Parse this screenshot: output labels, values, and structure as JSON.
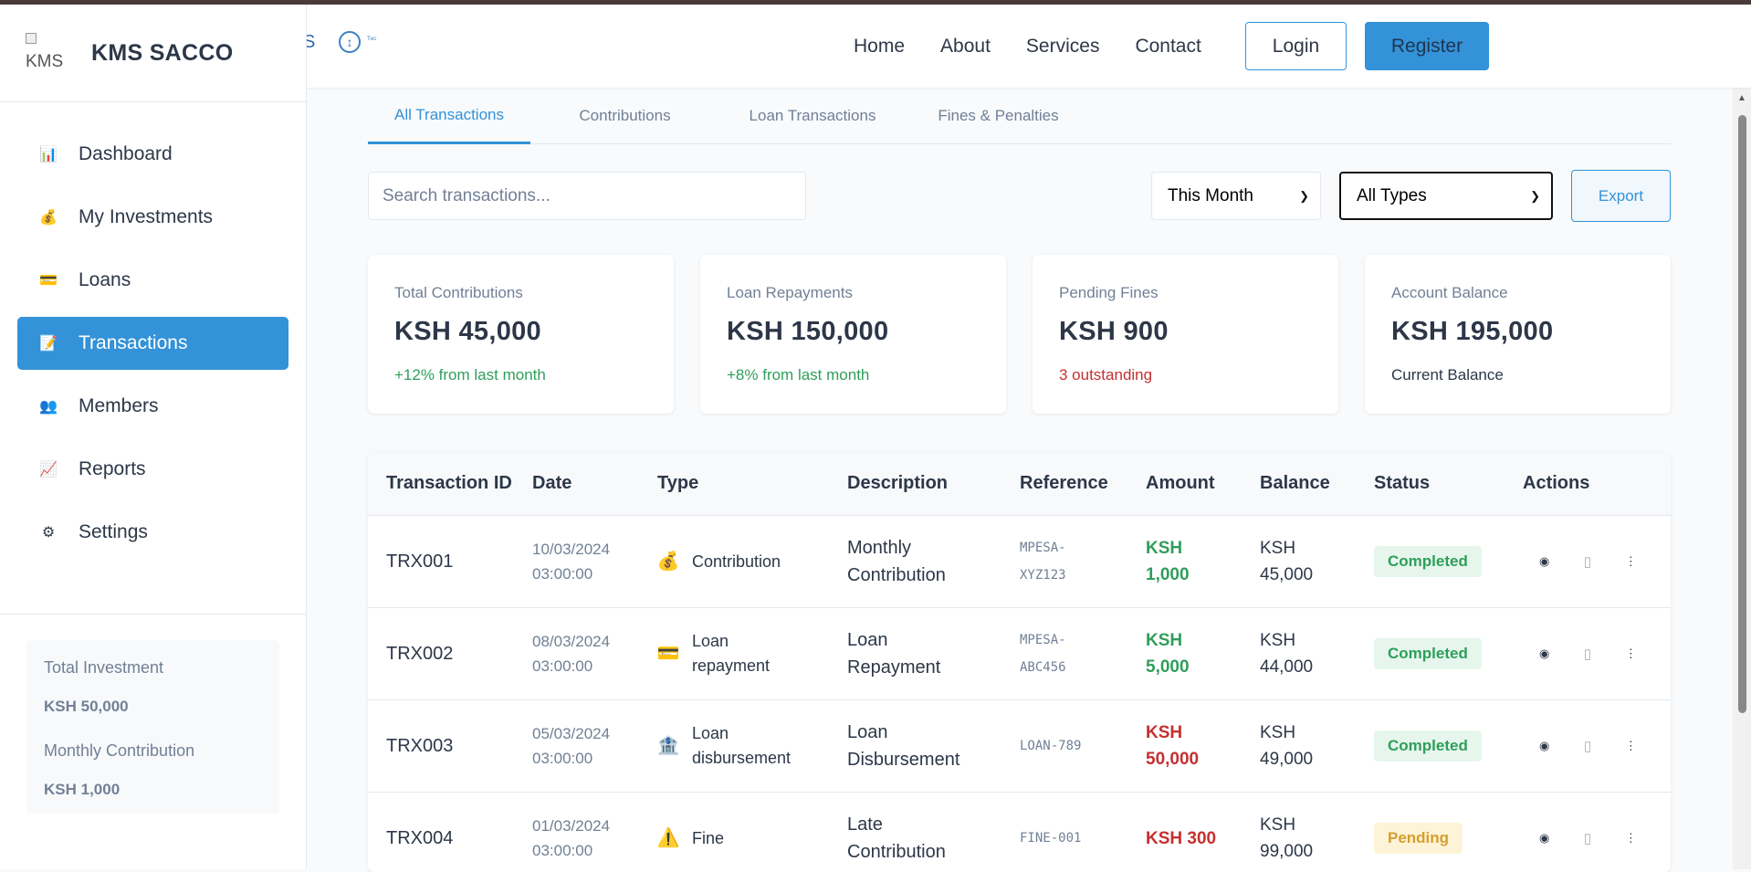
{
  "brand": {
    "logo_alt": "KMS",
    "name": "KMS SACCO"
  },
  "sidebar": {
    "items": [
      {
        "label": "Dashboard",
        "icon": "bar-chart-icon",
        "glyph": "📊"
      },
      {
        "label": "My Investments",
        "icon": "money-bag-icon",
        "glyph": "💰"
      },
      {
        "label": "Loans",
        "icon": "credit-card-icon",
        "glyph": "💳"
      },
      {
        "label": "Transactions",
        "icon": "memo-icon",
        "glyph": "📝"
      },
      {
        "label": "Members",
        "icon": "people-icon",
        "glyph": "👥"
      },
      {
        "label": "Reports",
        "icon": "trend-chart-icon",
        "glyph": "📈"
      },
      {
        "label": "Settings",
        "icon": "gear-icon",
        "glyph": "⚙"
      }
    ],
    "active_index": 3,
    "summary": {
      "total_investment_label": "Total Investment",
      "total_investment_value": "KSH 50,000",
      "monthly_contribution_label": "Monthly Contribution",
      "monthly_contribution_value": "KSH 1,000"
    }
  },
  "header": {
    "logo_fragment": "S",
    "icon_text": "ᵀᵉᶜ",
    "nav": [
      "Home",
      "About",
      "Services",
      "Contact"
    ],
    "login_label": "Login",
    "register_label": "Register"
  },
  "tabs": [
    "All Transactions",
    "Contributions",
    "Loan Transactions",
    "Fines & Penalties"
  ],
  "filters": {
    "search_placeholder": "Search transactions...",
    "period_selected": "This Month",
    "type_selected": "All Types",
    "export_label": "Export"
  },
  "cards": [
    {
      "label": "Total Contributions",
      "value": "KSH 45,000",
      "sub": "+12% from last month",
      "sub_color": "green"
    },
    {
      "label": "Loan Repayments",
      "value": "KSH 150,000",
      "sub": "+8% from last month",
      "sub_color": "green"
    },
    {
      "label": "Pending Fines",
      "value": "KSH 900",
      "sub": "3 outstanding",
      "sub_color": "red"
    },
    {
      "label": "Account Balance",
      "value": "KSH 195,000",
      "sub": "Current Balance",
      "sub_color": "dark"
    }
  ],
  "table": {
    "columns": [
      "Transaction ID",
      "Date",
      "Type",
      "Description",
      "Reference",
      "Amount",
      "Balance",
      "Status",
      "Actions"
    ],
    "rows": [
      {
        "id": "TRX001",
        "date": "10/03/2024",
        "time": "03:00:00",
        "type_icon": "money-bag-icon",
        "type_glyph": "💰",
        "type_l1": "Contribution",
        "type_l2": "",
        "desc_l1": "Monthly",
        "desc_l2": "Contribution",
        "ref_l1": "MPESA-",
        "ref_l2": "XYZ123",
        "amt_l1": "KSH",
        "amt_l2": "1,000",
        "amt_color": "green",
        "bal_l1": "KSH",
        "bal_l2": "45,000",
        "status": "Completed",
        "status_kind": "completed"
      },
      {
        "id": "TRX002",
        "date": "08/03/2024",
        "time": "03:00:00",
        "type_icon": "credit-card-icon",
        "type_glyph": "💳",
        "type_l1": "Loan",
        "type_l2": "repayment",
        "desc_l1": "Loan",
        "desc_l2": "Repayment",
        "ref_l1": "MPESA-",
        "ref_l2": "ABC456",
        "amt_l1": "KSH",
        "amt_l2": "5,000",
        "amt_color": "green",
        "bal_l1": "KSH",
        "bal_l2": "44,000",
        "status": "Completed",
        "status_kind": "completed"
      },
      {
        "id": "TRX003",
        "date": "05/03/2024",
        "time": "03:00:00",
        "type_icon": "bank-icon",
        "type_glyph": "🏦",
        "type_l1": "Loan",
        "type_l2": "disbursement",
        "desc_l1": "Loan",
        "desc_l2": "Disbursement",
        "ref_l1": "LOAN-789",
        "ref_l2": "",
        "amt_l1": "KSH",
        "amt_l2": "50,000",
        "amt_color": "red",
        "bal_l1": "KSH",
        "bal_l2": "49,000",
        "status": "Completed",
        "status_kind": "completed"
      },
      {
        "id": "TRX004",
        "date": "01/03/2024",
        "time": "03:00:00",
        "type_icon": "warning-icon",
        "type_glyph": "⚠️",
        "type_l1": "Fine",
        "type_l2": "",
        "desc_l1": "Late",
        "desc_l2": "Contribution",
        "ref_l1": "FINE-001",
        "ref_l2": "",
        "amt_l1": "KSH 300",
        "amt_l2": "",
        "amt_color": "red",
        "bal_l1": "KSH",
        "bal_l2": "99,000",
        "status": "Pending",
        "status_kind": "pending"
      }
    ],
    "action_icons": [
      "eye-icon",
      "document-icon",
      "more-icon"
    ]
  },
  "colors": {
    "accent": "#3392d8",
    "green": "#2f9e5b",
    "red": "#c53030",
    "pending": "#d69e2e"
  }
}
